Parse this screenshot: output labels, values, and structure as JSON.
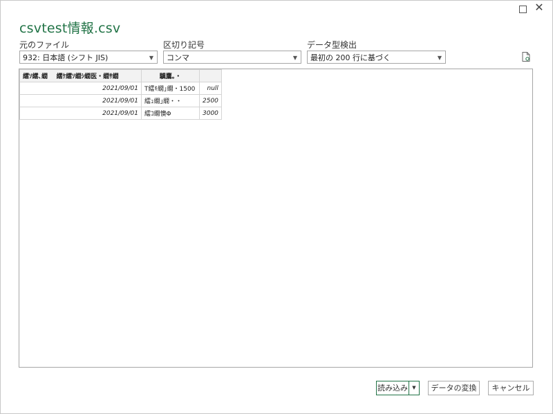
{
  "window": {
    "title": "csvtest情報.csv",
    "close_glyph": "✕"
  },
  "file_origin": {
    "label": "元のファイル",
    "value": "932: 日本語 (シフト JIS)"
  },
  "delimiter": {
    "label": "区切り記号",
    "value": "コンマ"
  },
  "type_detection": {
    "label": "データ型検出",
    "value": "最初の 200 行に基づく"
  },
  "table": {
    "headers": [
      "繧ｿ繧､繝",
      "繧ｹ繧ｿ繝ｼ繝医・繝ｻ繝",
      "驥鷹｡・"
    ],
    "rows": [
      [
        "2021/09/01",
        "T繧ｷ繝｣繝・1500",
        "null"
      ],
      [
        "2021/09/01",
        "繧ｭ繝｣繝・・",
        "2500"
      ],
      [
        "2021/09/01",
        "繧ｺ繝懊Φ",
        "3000"
      ]
    ]
  },
  "buttons": {
    "load": "読み込み",
    "transform": "データの変換",
    "cancel": "キャンセル"
  },
  "colors": {
    "accent": "#217346"
  }
}
